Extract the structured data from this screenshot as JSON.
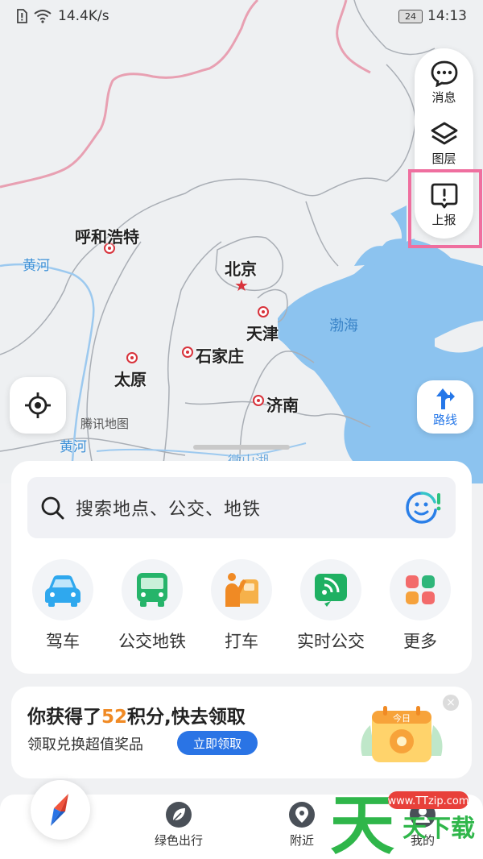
{
  "status_bar": {
    "network_speed": "14.4K/s",
    "battery_level": "24",
    "time": "14:13"
  },
  "map": {
    "cities": [
      {
        "name": "呼和浩特"
      },
      {
        "name": "北京"
      },
      {
        "name": "天津"
      },
      {
        "name": "石家庄"
      },
      {
        "name": "太原"
      },
      {
        "name": "济南"
      }
    ],
    "water_labels": {
      "yellow_river_1": "黄河",
      "yellow_river_2": "黄河",
      "bohai": "渤海",
      "lake": "微山湖"
    },
    "provider": "腾讯地图"
  },
  "side_panel": {
    "messages": "消息",
    "layers": "图层",
    "report": "上报"
  },
  "route_button": "路线",
  "search": {
    "placeholder": "搜索地点、公交、地铁"
  },
  "quick_actions": [
    {
      "label": "驾车",
      "icon": "car-icon"
    },
    {
      "label": "公交地铁",
      "icon": "bus-icon"
    },
    {
      "label": "打车",
      "icon": "taxi-icon"
    },
    {
      "label": "实时公交",
      "icon": "realtime-bus-icon"
    },
    {
      "label": "更多",
      "icon": "more-grid-icon"
    }
  ],
  "promo": {
    "title_prefix": "你获得了",
    "points": "52",
    "title_suffix": "积分,快去领取",
    "subtitle": "领取兑换超值奖品",
    "claim_button": "立即领取",
    "calendar_label": "今日"
  },
  "bottom_nav": {
    "green_travel": "绿色出行",
    "nearby": "附近",
    "mine": "我的"
  },
  "watermark": {
    "site": "www.TTzip.com",
    "brand": "天天下载"
  },
  "colors": {
    "accent_blue": "#2577e8",
    "highlight_pink": "#ef6f9f",
    "points_orange": "#f08a24"
  }
}
